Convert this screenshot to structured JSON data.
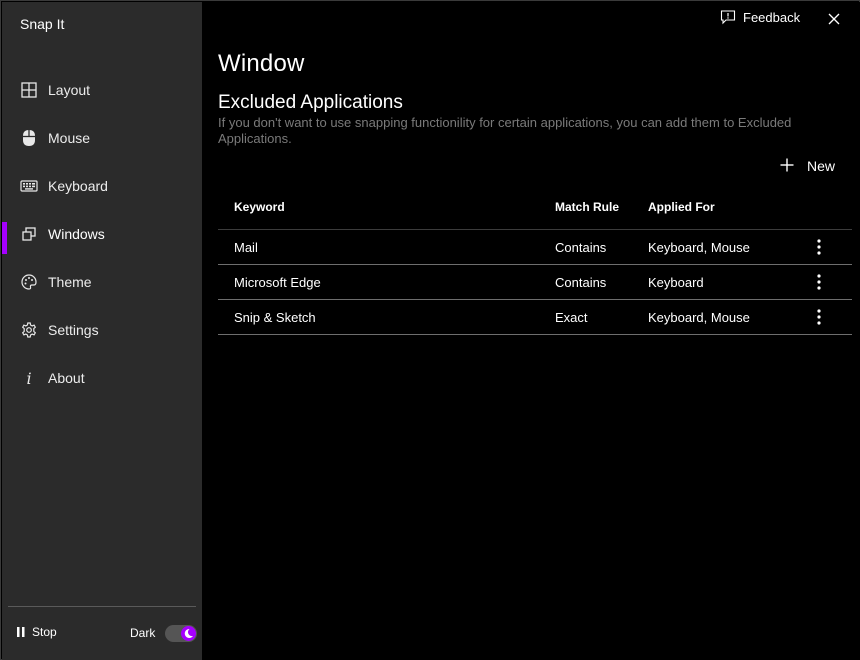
{
  "app": {
    "title": "Snap It"
  },
  "sidebar": {
    "items": [
      {
        "label": "Layout",
        "icon": "grid-icon"
      },
      {
        "label": "Mouse",
        "icon": "mouse-icon"
      },
      {
        "label": "Keyboard",
        "icon": "keyboard-icon"
      },
      {
        "label": "Windows",
        "icon": "windows-icon",
        "active": true
      },
      {
        "label": "Theme",
        "icon": "palette-icon"
      },
      {
        "label": "Settings",
        "icon": "gear-icon"
      },
      {
        "label": "About",
        "icon": "info-icon"
      }
    ],
    "stop_label": "Stop",
    "dark_label": "Dark",
    "dark_enabled": true
  },
  "topbar": {
    "feedback_label": "Feedback"
  },
  "main": {
    "page_title": "Window",
    "section_title": "Excluded Applications",
    "section_description": "If you don't want to use snapping functionility for certain applications, you can add them to Excluded Applications.",
    "new_label": "New",
    "table": {
      "headers": [
        "Keyword",
        "Match Rule",
        "Applied For"
      ],
      "rows": [
        {
          "keyword": "Mail",
          "match_rule": "Contains",
          "applied_for": "Keyboard, Mouse"
        },
        {
          "keyword": "Microsoft Edge",
          "match_rule": "Contains",
          "applied_for": "Keyboard"
        },
        {
          "keyword": "Snip & Sketch",
          "match_rule": "Exact",
          "applied_for": "Keyboard, Mouse"
        }
      ]
    }
  },
  "colors": {
    "accent": "#a600ff",
    "sidebar_bg": "#2b2b2b",
    "main_bg": "#000000",
    "muted_text": "#7a7a7a"
  }
}
